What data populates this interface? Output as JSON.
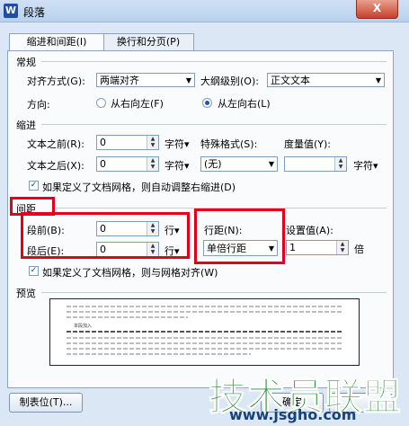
{
  "window": {
    "title": "段落",
    "app_icon": "W",
    "close": "X"
  },
  "tabs": [
    {
      "label": "缩进和间距(I)",
      "active": true
    },
    {
      "label": "换行和分页(P)",
      "active": false
    }
  ],
  "general": {
    "header": "常规",
    "alignment_label": "对齐方式(G):",
    "alignment_value": "两端对齐",
    "outline_label": "大纲级别(O):",
    "outline_value": "正文文本",
    "direction_label": "方向:",
    "rtl_label": "从右向左(F)",
    "ltr_label": "从左向右(L)",
    "selected": "ltr"
  },
  "indent": {
    "header": "缩进",
    "before_label": "文本之前(R):",
    "before_value": "0",
    "before_unit": "字符▾",
    "after_label": "文本之后(X):",
    "after_value": "0",
    "after_unit": "字符▾",
    "special_label": "特殊格式(S):",
    "special_value": "(无)",
    "measure_label": "度量值(Y):",
    "measure_value": "",
    "measure_unit": "字符▾",
    "grid_check_label": "如果定义了文档网格，则自动调整右缩进(D)",
    "grid_checked": true
  },
  "spacing": {
    "header": "间距",
    "before_label": "段前(B):",
    "before_value": "0",
    "before_unit": "行▾",
    "after_label": "段后(E):",
    "after_value": "0",
    "after_unit": "行▾",
    "line_label": "行距(N):",
    "line_value": "单倍行距",
    "setting_label": "设置值(A):",
    "setting_value": "1",
    "setting_unit": "倍",
    "grid_check_label": "如果定义了文档网格，则与网格对齐(W)",
    "grid_checked": true
  },
  "preview": {
    "header": "预览",
    "sample_text": "本段加入"
  },
  "buttons": {
    "tabs": "制表位(T)...",
    "ok": "确定"
  },
  "watermark": {
    "main": "技术员联盟",
    "url": "www.jsgho.com"
  },
  "colors": {
    "highlight": "#e4001b",
    "accent": "#2456a8",
    "watermark": "#2c8a34"
  }
}
